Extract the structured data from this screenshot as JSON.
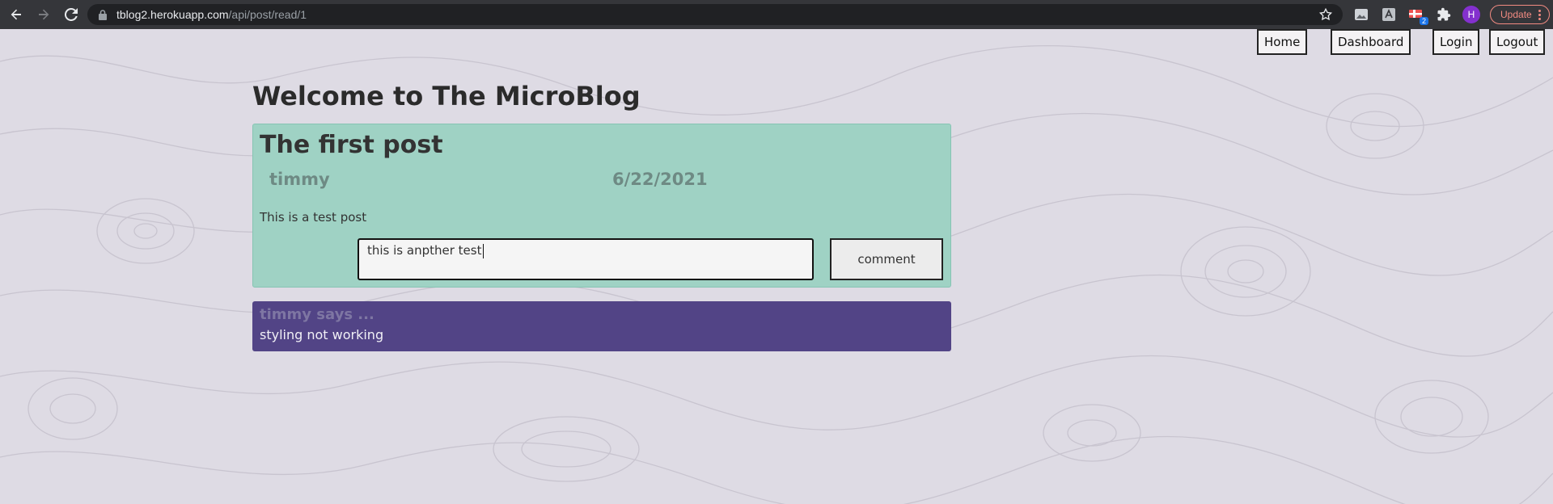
{
  "browser": {
    "url_host": "tblog2.herokuapp.com",
    "url_path": "/api/post/read/1",
    "profile_initial": "H",
    "extension_badge": "2",
    "update_label": "Update",
    "icons": [
      "back-icon",
      "forward-icon",
      "reload-icon",
      "lock-icon",
      "star-icon",
      "extension-icon",
      "puzzle-icon",
      "more-icon"
    ]
  },
  "nav": {
    "home": "Home",
    "dashboard": "Dashboard",
    "login": "Login",
    "logout": "Logout"
  },
  "page": {
    "title": "Welcome to The MicroBlog"
  },
  "post": {
    "title": "The first post",
    "author": "timmy",
    "date": "6/22/2021",
    "body": "This is a test post",
    "comment_input_value": "this is anpther test",
    "comment_button": "comment"
  },
  "comments": [
    {
      "author": "timmy says ...",
      "text": "styling not working"
    }
  ],
  "colors": {
    "background": "#dedbe4",
    "post_card": "#9fd2c4",
    "comment_card": "#524486"
  }
}
